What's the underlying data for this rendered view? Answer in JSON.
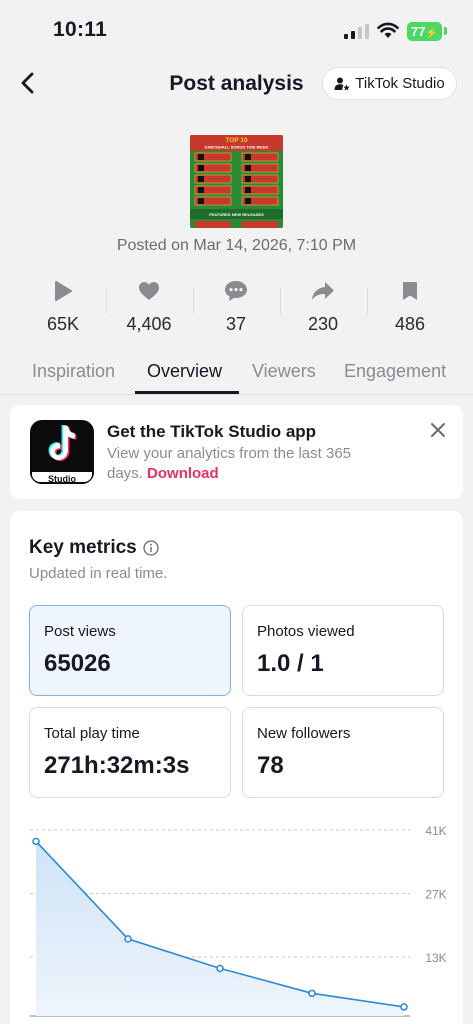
{
  "status_bar": {
    "time": "10:11",
    "battery": "77"
  },
  "header": {
    "title": "Post analysis",
    "studio_button": "TikTok Studio"
  },
  "post": {
    "thumbnail_title": "TOP 10",
    "thumbnail_subtitle": "DANCEHALL SONGS THIS WEEK",
    "thumbnail_footer": "FEATURED NEW RELEASES",
    "posted": "Posted on Mar 14, 2026, 7:10 PM"
  },
  "stats": {
    "plays": "65K",
    "likes": "4,406",
    "comments": "37",
    "shares": "230",
    "saves": "486"
  },
  "tabs": [
    "Inspiration",
    "Overview",
    "Viewers",
    "Engagement"
  ],
  "banner": {
    "title": "Get the TikTok Studio app",
    "description": "View your analytics from the last 365 days.",
    "link": "Download",
    "icon_label": "Studio"
  },
  "key_metrics": {
    "title": "Key metrics",
    "subtitle": "Updated in real time.",
    "cards": [
      {
        "label": "Post views",
        "value": "65026"
      },
      {
        "label": "Photos viewed",
        "value": "1.0 / 1"
      },
      {
        "label": "Total play time",
        "value": "271h:32m:3s"
      },
      {
        "label": "New followers",
        "value": "78"
      }
    ]
  },
  "colors": {
    "accent_pink": "#e8345b",
    "line_blue": "#2f87d8",
    "battery_green": "#4bd865"
  },
  "chart_data": {
    "type": "area",
    "x": [
      1,
      2,
      3,
      4,
      5
    ],
    "values": [
      38500,
      17000,
      10500,
      5000,
      2000
    ],
    "ylim": [
      0,
      41000
    ],
    "y_ticks": [
      "41K",
      "27K",
      "13K"
    ],
    "y_tick_values": [
      41000,
      27000,
      13000
    ],
    "grid": true
  }
}
